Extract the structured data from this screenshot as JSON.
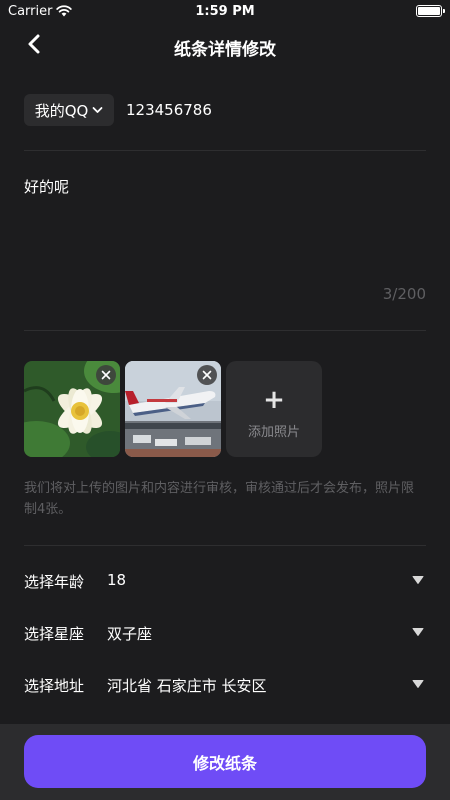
{
  "status_bar": {
    "carrier": "Carrier",
    "time": "1:59 PM"
  },
  "nav": {
    "title": "纸条详情修改",
    "back_icon": "chevron-left-icon"
  },
  "contact": {
    "type": "我的QQ",
    "value": "123456786"
  },
  "note": {
    "text": "好的呢",
    "char_count": "3/200"
  },
  "photos": {
    "add_label": "添加照片",
    "count": 2
  },
  "notice": "我们将对上传的图片和内容进行审核，审核通过后才会发布，照片限制4张。",
  "selects": [
    {
      "label": "选择年龄",
      "value": "18"
    },
    {
      "label": "选择星座",
      "value": "双子座"
    },
    {
      "label": "选择地址",
      "value": "河北省 石家庄市 长安区"
    }
  ],
  "submit": {
    "label": "修改纸条"
  },
  "colors": {
    "background": "#1c1c1e",
    "accent": "#6f4cf6",
    "card": "#2c2c2e"
  }
}
